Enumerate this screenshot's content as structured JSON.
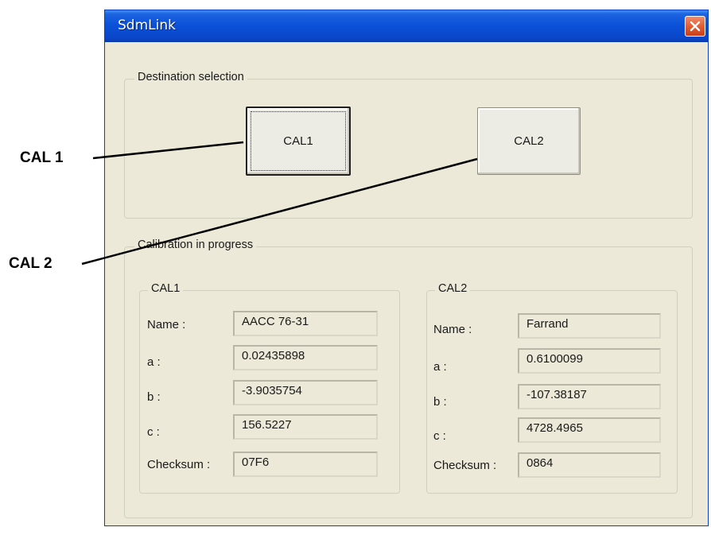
{
  "window": {
    "title": "SdmLink",
    "close_icon": "close-icon"
  },
  "destination": {
    "label": "Destination selection",
    "buttons": [
      {
        "label": "CAL1",
        "default": true
      },
      {
        "label": "CAL2",
        "default": false
      }
    ]
  },
  "calibration": {
    "label": "Calibration in progress",
    "groups": [
      {
        "label": "CAL1",
        "fields": [
          {
            "label": "Name :",
            "value": "AACC 76-31"
          },
          {
            "label": "a :",
            "value": "0.02435898"
          },
          {
            "label": "b :",
            "value": "-3.9035754"
          },
          {
            "label": "c :",
            "value": "156.5227"
          },
          {
            "label": "Checksum :",
            "value": "07F6"
          }
        ]
      },
      {
        "label": "CAL2",
        "fields": [
          {
            "label": "Name :",
            "value": "Farrand"
          },
          {
            "label": "a :",
            "value": "0.6100099"
          },
          {
            "label": "b :",
            "value": "-107.38187"
          },
          {
            "label": "c :",
            "value": "4728.4965"
          },
          {
            "label": "Checksum :",
            "value": "0864"
          }
        ]
      }
    ]
  },
  "annotations": {
    "cal1": "CAL 1",
    "cal2": "CAL 2"
  },
  "colors": {
    "titlebar": "#0a50d8",
    "dialog_bg": "#ece9d8",
    "close_button": "#e05a30"
  }
}
